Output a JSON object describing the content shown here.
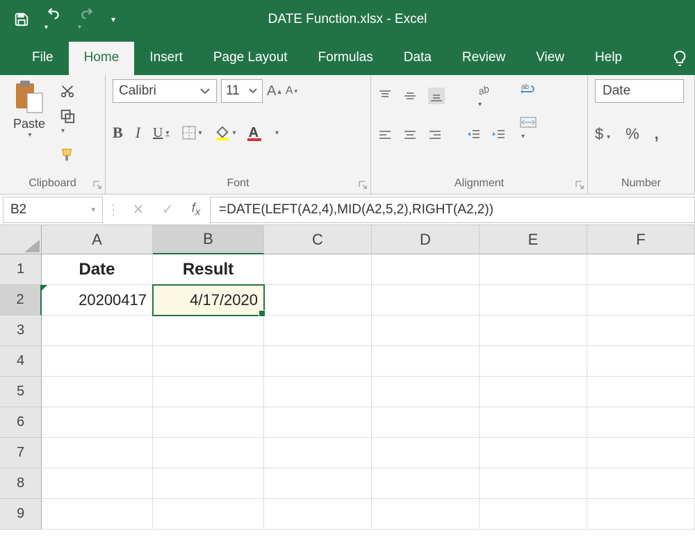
{
  "titlebar": {
    "title": "DATE Function.xlsx  -  Excel"
  },
  "tabs": {
    "file": "File",
    "home": "Home",
    "insert": "Insert",
    "pagelayout": "Page Layout",
    "formulas": "Formulas",
    "data": "Data",
    "review": "Review",
    "view": "View",
    "help": "Help"
  },
  "clipboard": {
    "paste": "Paste",
    "label": "Clipboard"
  },
  "font": {
    "name": "Calibri",
    "size": "11",
    "label": "Font"
  },
  "alignment": {
    "label": "Alignment"
  },
  "number": {
    "format": "Date",
    "label": "Number"
  },
  "namebox": "B2",
  "formula": "=DATE(LEFT(A2,4),MID(A2,5,2),RIGHT(A2,2))",
  "columns": [
    "A",
    "B",
    "C",
    "D",
    "E",
    "F"
  ],
  "rows": [
    "1",
    "2",
    "3",
    "4",
    "5",
    "6",
    "7",
    "8",
    "9"
  ],
  "cells": {
    "A1": "Date",
    "B1": "Result",
    "A2": "20200417",
    "B2": "4/17/2020"
  }
}
